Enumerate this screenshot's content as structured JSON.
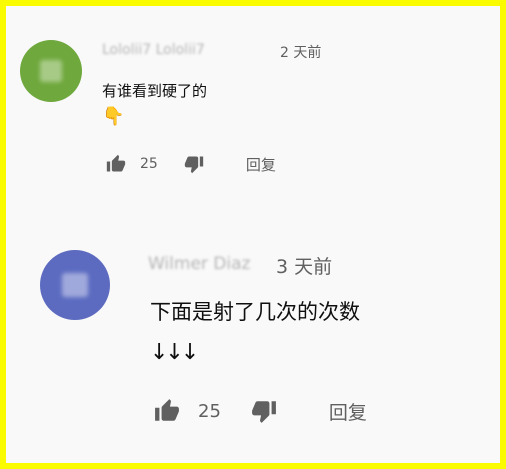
{
  "comment": {
    "author": "Lololii7 Lololii7",
    "time": "2 天前",
    "text": "有谁看到硬了的",
    "emoji": "👇",
    "likes": "25",
    "reply_label": "回复",
    "avatar_color": "#6fa83d"
  },
  "reply": {
    "author": "Wilmer Diaz",
    "time": "3 天前",
    "text": "下面是射了几次的次数",
    "arrows": "↓↓↓",
    "likes": "25",
    "reply_label": "回复",
    "avatar_color": "#5c6bc0"
  },
  "icons": {
    "like": "thumbs-up-icon",
    "dislike": "thumbs-down-icon"
  }
}
